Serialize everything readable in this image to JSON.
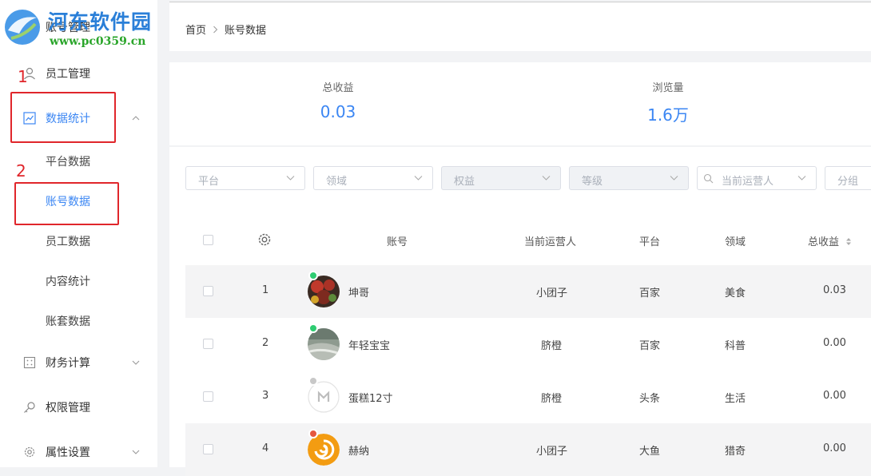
{
  "watermark": {
    "title": "河东软件园",
    "url": "www.pc0359.cn"
  },
  "sidebar": {
    "items": [
      {
        "label": "账号管理"
      },
      {
        "label": "员工管理"
      },
      {
        "label": "数据统计"
      },
      {
        "label": "财务计算"
      },
      {
        "label": "权限管理"
      },
      {
        "label": "属性设置"
      }
    ],
    "sub_items": [
      {
        "label": "平台数据"
      },
      {
        "label": "账号数据"
      },
      {
        "label": "员工数据"
      },
      {
        "label": "内容统计"
      },
      {
        "label": "账套数据"
      }
    ]
  },
  "annotations": [
    "1",
    "2"
  ],
  "breadcrumb": {
    "home": "首页",
    "current": "账号数据"
  },
  "stats": [
    {
      "label": "总收益",
      "value": "0.03"
    },
    {
      "label": "浏览量",
      "value": "1.6万"
    }
  ],
  "filters": [
    {
      "placeholder": "平台"
    },
    {
      "placeholder": "领域"
    },
    {
      "placeholder": "权益"
    },
    {
      "placeholder": "等级"
    },
    {
      "placeholder": "当前运营人"
    },
    {
      "placeholder": "分组"
    }
  ],
  "table": {
    "columns": [
      "账号",
      "当前运营人",
      "平台",
      "领域",
      "总收益"
    ],
    "rows": [
      {
        "index": "1",
        "account": "坤哥",
        "operator": "小团子",
        "platform": "百家",
        "field": "美食",
        "revenue": "0.03",
        "status": "online"
      },
      {
        "index": "2",
        "account": "年轻宝宝",
        "operator": "脐橙",
        "platform": "百家",
        "field": "科普",
        "revenue": "0.00",
        "status": "online"
      },
      {
        "index": "3",
        "account": "蛋糕12寸",
        "operator": "脐橙",
        "platform": "头条",
        "field": "生活",
        "revenue": "0.00",
        "status": "offline"
      },
      {
        "index": "4",
        "account": "赫纳",
        "operator": "小团子",
        "platform": "大鱼",
        "field": "猎奇",
        "revenue": "0.00",
        "status": "error"
      }
    ]
  },
  "colors": {
    "accent": "#3b86f3",
    "annotation": "#e0262b",
    "online": "#2ecc71",
    "offline": "#c8c8c8",
    "error": "#e5573f"
  }
}
